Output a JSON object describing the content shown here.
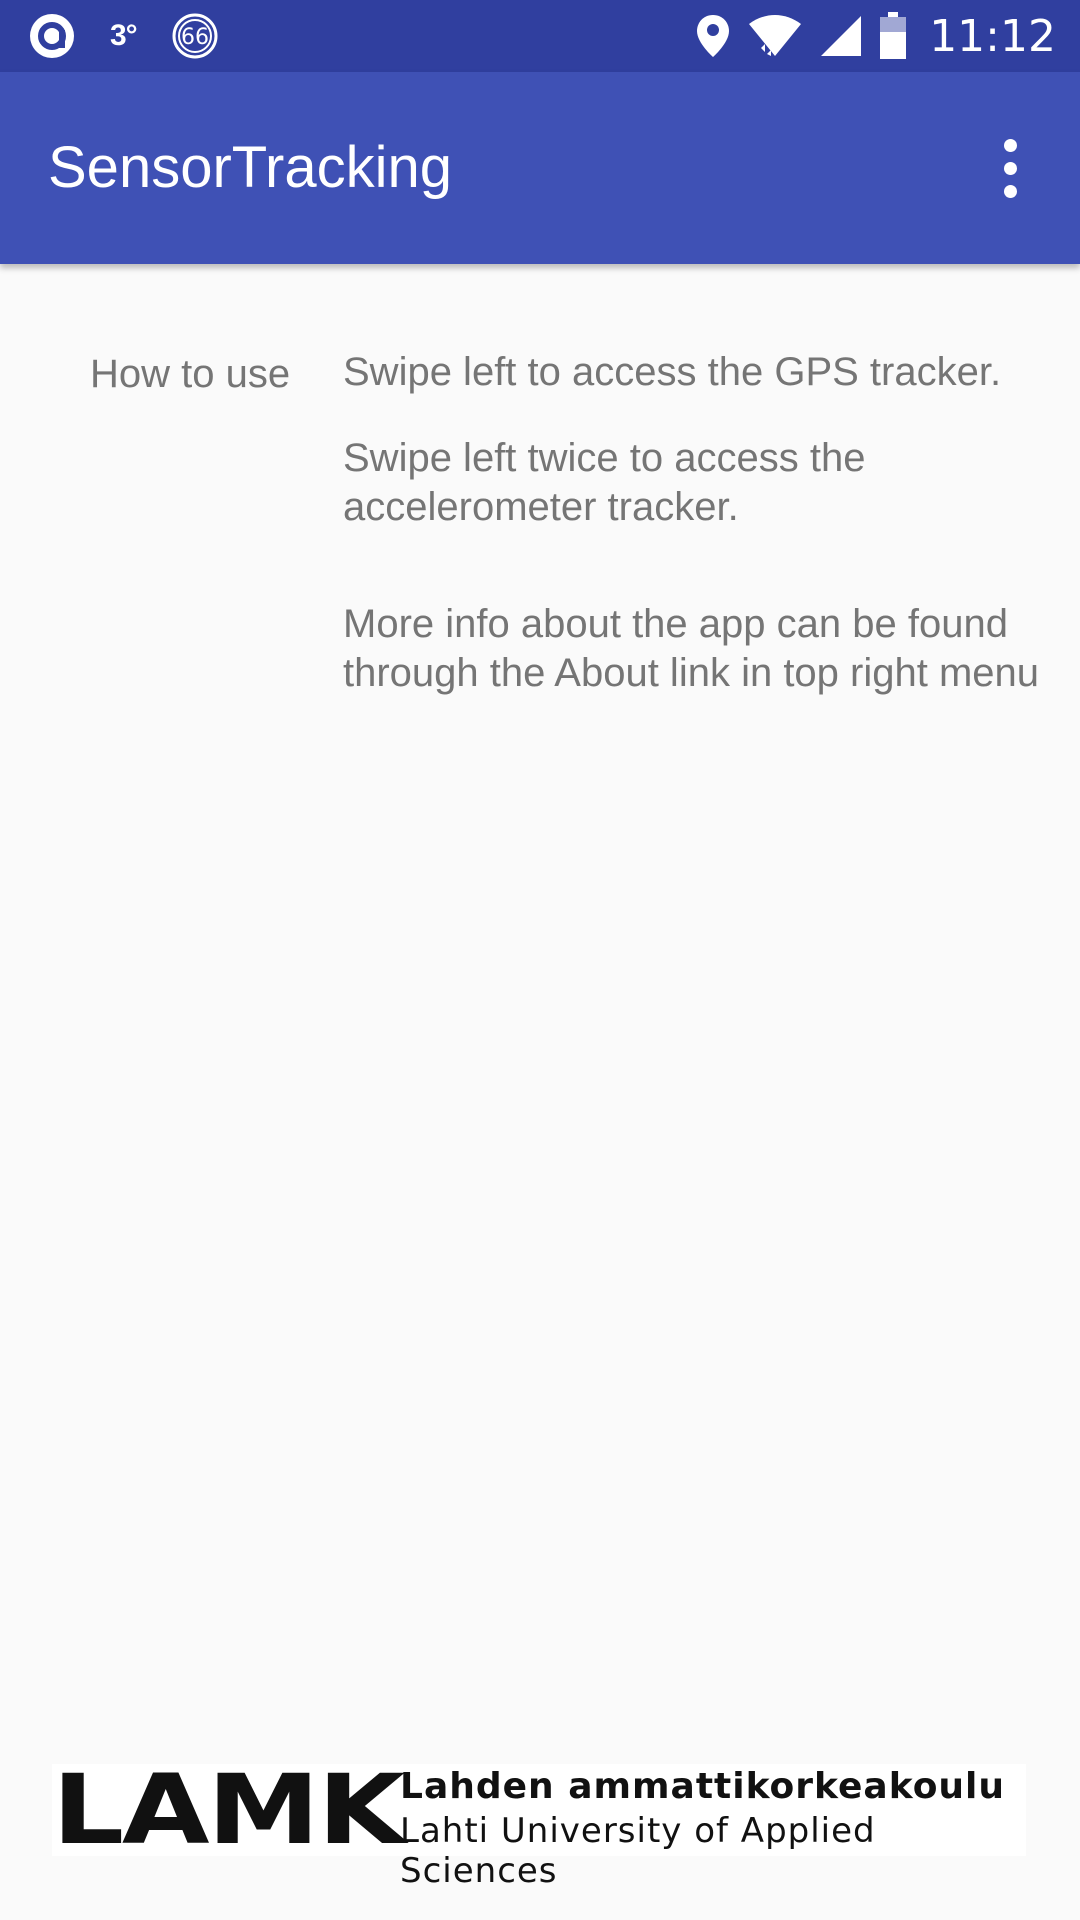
{
  "status_bar": {
    "temperature": "3°",
    "badge_number": "66",
    "time": "11:12",
    "icons": [
      "app-notification-icon",
      "temperature-icon",
      "badge-66-icon",
      "location-icon",
      "wifi-icon",
      "signal-icon",
      "battery-icon"
    ]
  },
  "app_bar": {
    "title": "SensorTracking",
    "menu_icon": "more-vert-icon",
    "background": "#3f51b5",
    "status_background": "#303f9f"
  },
  "content": {
    "label": "How to use",
    "paragraphs": [
      "Swipe left to access the GPS tracker.",
      "Swipe left twice to access the accelerometer tracker.",
      "More info about the app can be found through the About link in top right menu"
    ]
  },
  "footer_logo": {
    "mark": "LAMK",
    "line1": "Lahden ammattikorkeakoulu",
    "line2": "Lahti University of Applied Sciences"
  }
}
